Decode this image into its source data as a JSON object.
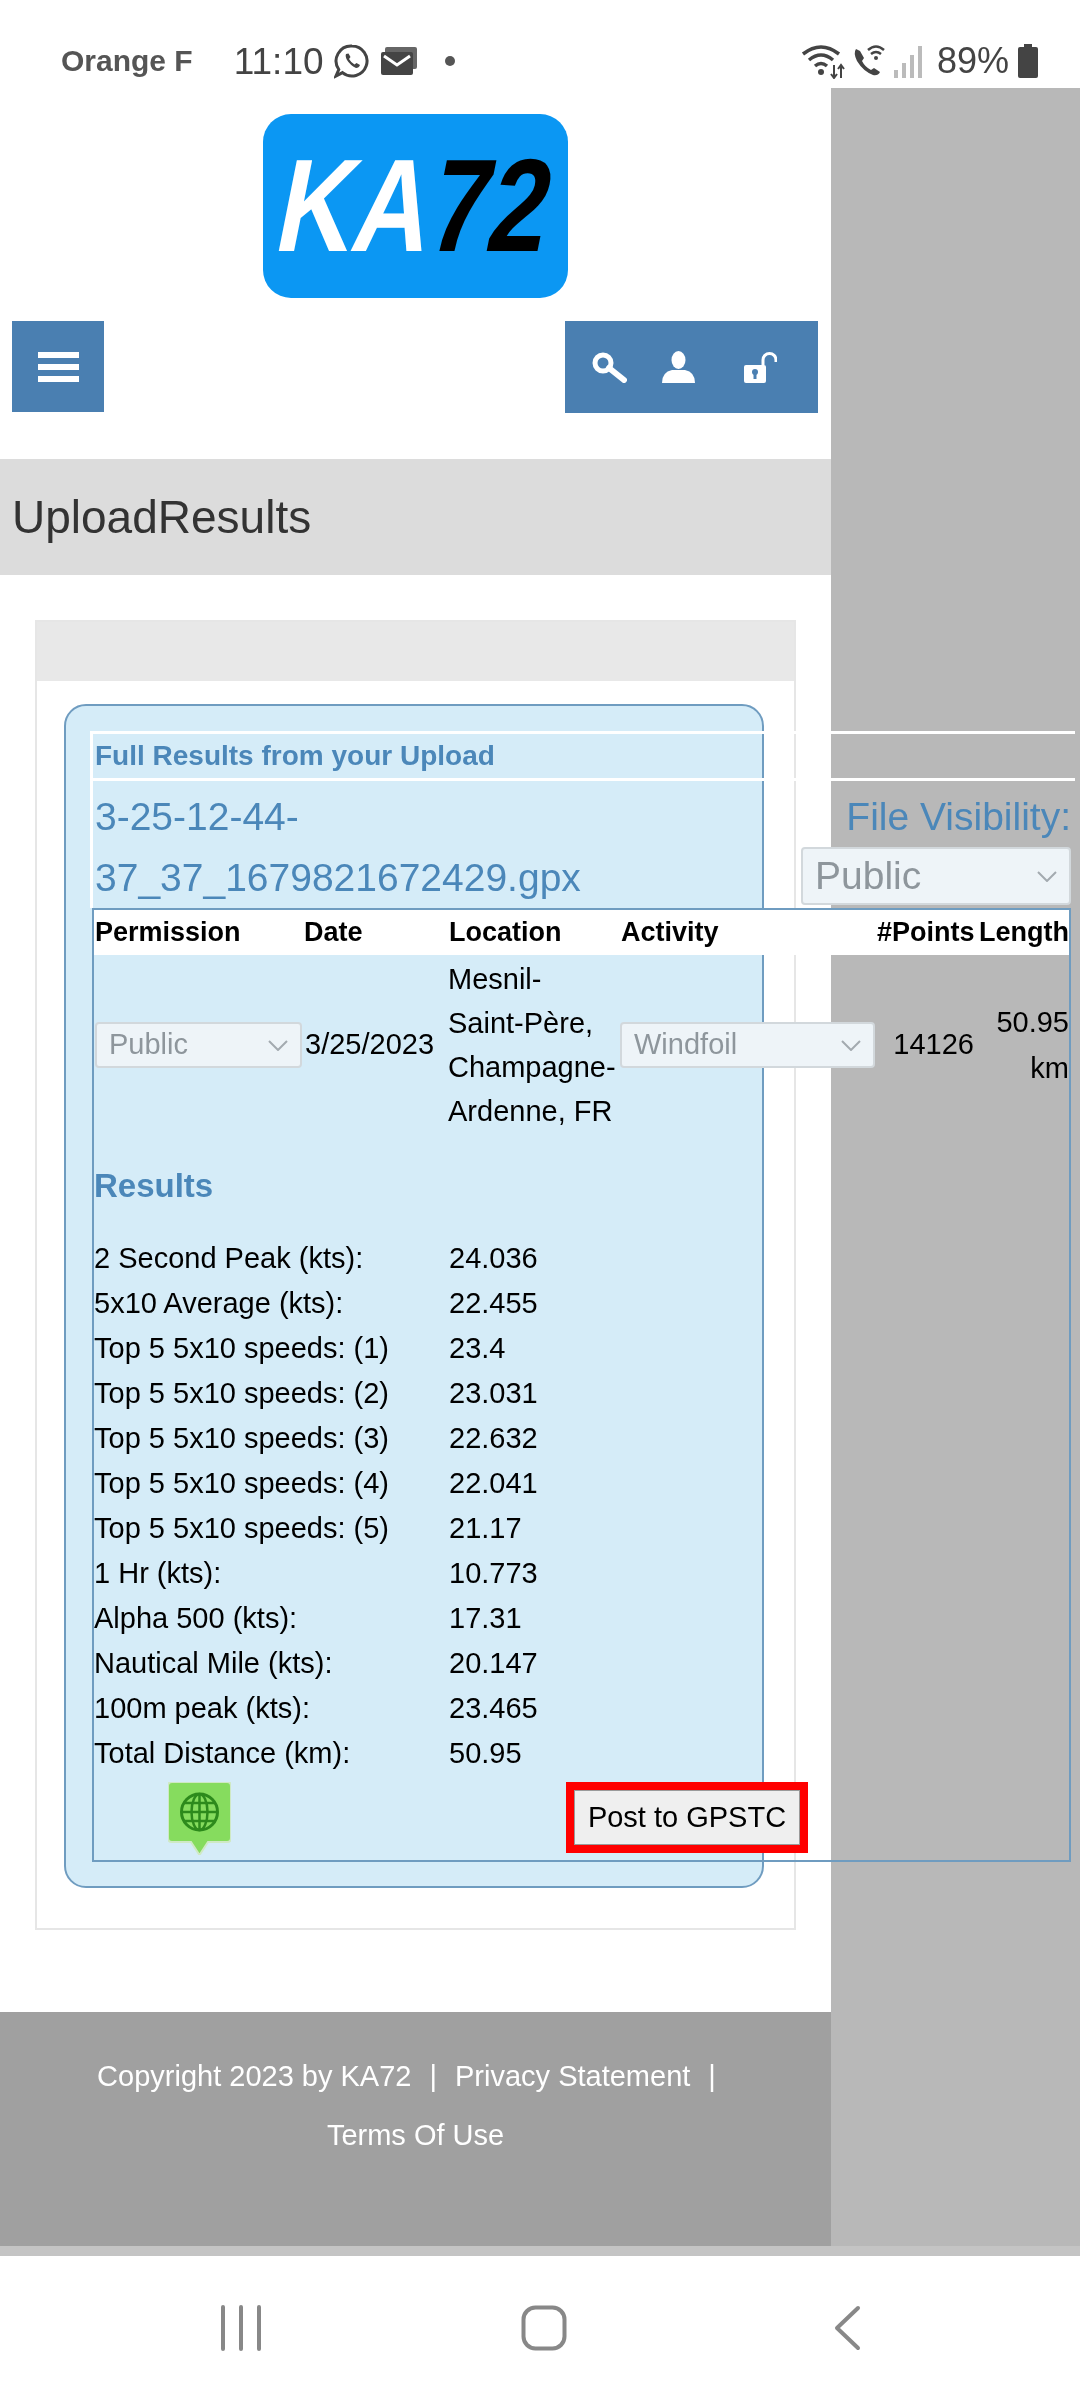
{
  "status_bar": {
    "carrier": "Orange F",
    "time": "11:10",
    "battery": "89%"
  },
  "logo": {
    "text": "KA72"
  },
  "page_title": "UploadResults",
  "upload": {
    "heading": "Full Results from your Upload",
    "filename": "3-25-12-44-37_37_1679821672429.gpx",
    "visibility_label": "File Visibility:",
    "visibility": {
      "value": "Public",
      "disabled": true
    }
  },
  "table": {
    "columns": [
      "Permission",
      "Date",
      "Location",
      "Activity",
      "#Points",
      "Length"
    ],
    "row": {
      "permission": {
        "value": "Public",
        "disabled": true
      },
      "date": "3/25/2023",
      "location": "Mesnil-Saint-Père, Champagne-Ardenne, FR",
      "activity": {
        "value": "Windfoil",
        "disabled": true
      },
      "points": "14126",
      "length": "50.95 km"
    }
  },
  "results": {
    "heading": "Results",
    "rows": [
      {
        "label": "2 Second Peak (kts):",
        "value": "24.036"
      },
      {
        "label": "5x10 Average (kts):",
        "value": "22.455"
      },
      {
        "label": "Top 5 5x10 speeds: (1)",
        "value": "23.4"
      },
      {
        "label": "Top 5 5x10 speeds: (2)",
        "value": "23.031"
      },
      {
        "label": "Top 5 5x10 speeds: (3)",
        "value": "22.632"
      },
      {
        "label": "Top 5 5x10 speeds: (4)",
        "value": "22.041"
      },
      {
        "label": "Top 5 5x10 speeds: (5)",
        "value": "21.17"
      },
      {
        "label": "1 Hr (kts):",
        "value": "10.773"
      },
      {
        "label": "Alpha 500 (kts):",
        "value": "17.31"
      },
      {
        "label": "Nautical Mile (kts):",
        "value": "20.147"
      },
      {
        "label": "100m peak (kts):",
        "value": "23.465"
      },
      {
        "label": "Total Distance (km):",
        "value": "50.95"
      }
    ]
  },
  "post_button": {
    "label": "Post to GPSTC",
    "highlighted": true
  },
  "footer": {
    "copyright": "Copyright 2023 by KA72",
    "links": [
      {
        "separator": "|",
        "label": "Privacy Statement"
      },
      {
        "separator": "|",
        "label": "Terms Of Use"
      }
    ]
  }
}
